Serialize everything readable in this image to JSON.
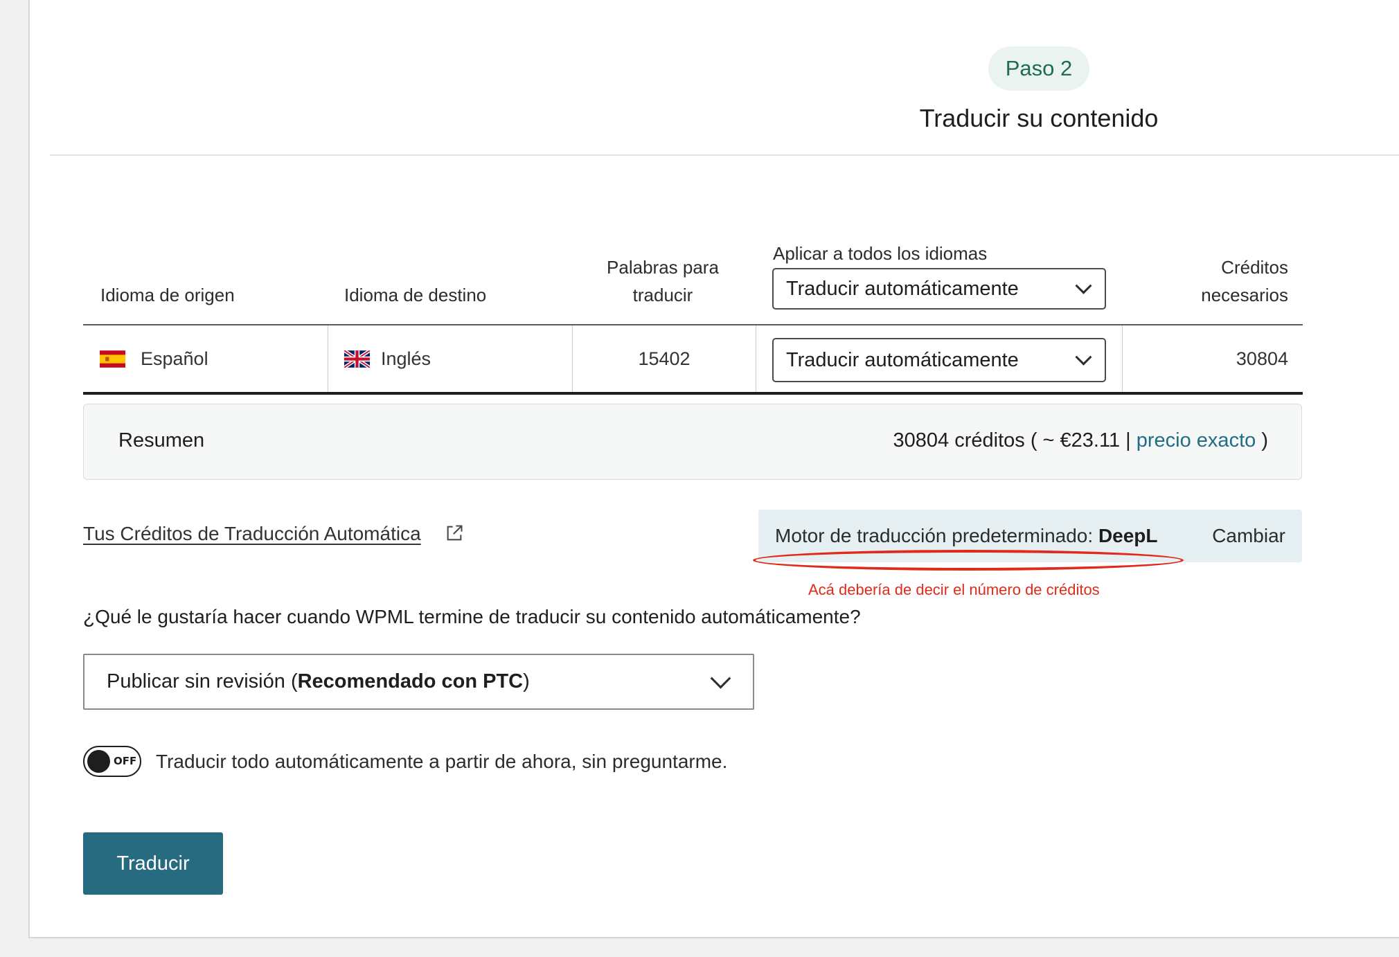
{
  "step": {
    "badge": "Paso 2",
    "title": "Traducir su contenido"
  },
  "table": {
    "headers": {
      "source": "Idioma de origen",
      "target": "Idioma de destino",
      "words_line1": "Palabras para",
      "words_line2": "traducir",
      "apply_all_label": "Aplicar a todos los idiomas",
      "apply_all_value": "Traducir automáticamente",
      "credits_line1": "Créditos",
      "credits_line2": "necesarios"
    },
    "rows": [
      {
        "source": "Español",
        "target": "Inglés",
        "words": "15402",
        "method": "Traducir automáticamente",
        "credits": "30804"
      }
    ]
  },
  "summary": {
    "label": "Resumen",
    "credits": "30804 créditos",
    "price_prefix": "( ~ €23.11 |",
    "exact_price_link": "precio exacto",
    "price_suffix": ")"
  },
  "credits_link": "Tus Créditos de Traducción Automática",
  "engine": {
    "label": "Motor de traducción predeterminado:",
    "name": "DeepL",
    "change": "Cambiar"
  },
  "annotation": {
    "note": "Acá debería de decir el número de créditos",
    "color": "#e02a1b"
  },
  "after_translation": {
    "question": "¿Qué le gustaría hacer cuando WPML termine de traducir su contenido automáticamente?",
    "selected_prefix": "Publicar sin revisión (",
    "selected_bold": "Recomendado con PTC",
    "selected_suffix": ")"
  },
  "auto_toggle": {
    "state": "OFF",
    "label": "Traducir todo automáticamente a partir de ahora, sin preguntarme."
  },
  "translate_button": "Traducir",
  "colors": {
    "primary": "#276b80",
    "link": "#1f6e86",
    "step_badge_bg": "#eaf3ef",
    "step_badge_text": "#1e6b4f",
    "engine_bg": "#e6f0f2"
  }
}
